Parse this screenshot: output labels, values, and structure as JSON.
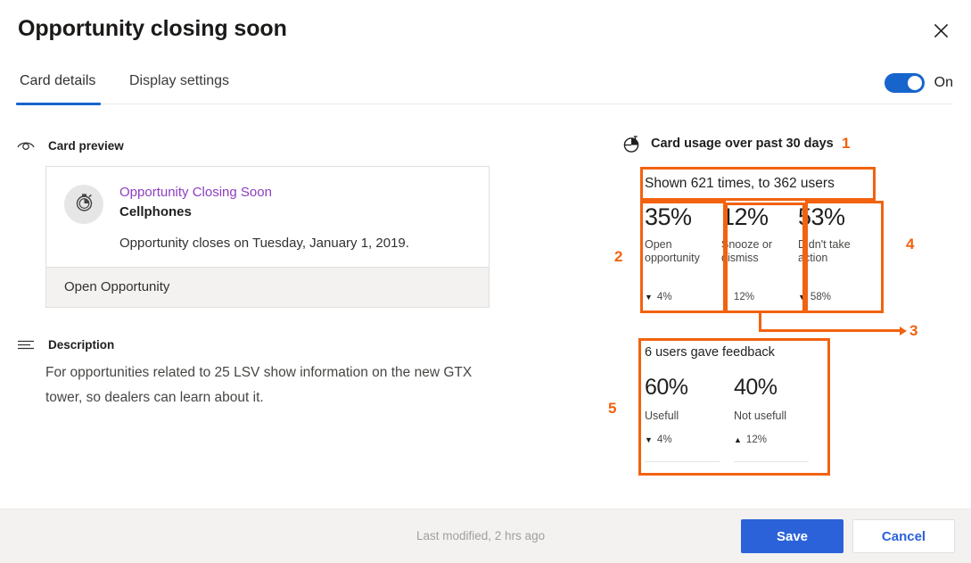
{
  "dialog": {
    "title": "Opportunity closing soon",
    "close_icon": "close-icon"
  },
  "tabs": {
    "items": [
      {
        "label": "Card details",
        "selected": true
      },
      {
        "label": "Display settings",
        "selected": false
      }
    ]
  },
  "toggle": {
    "state_label": "On",
    "on": true,
    "accent": "#1765cc"
  },
  "card_preview": {
    "section_label": "Card preview",
    "section_icon": "eye-icon",
    "avatar_icon": "stopwatch-icon",
    "link_title": "Opportunity Closing Soon",
    "subtitle": "Cellphones",
    "body_text": "Opportunity closes on Tuesday, January 1, 2019.",
    "action_label": "Open Opportunity",
    "link_color": "#8e3ec0"
  },
  "description": {
    "section_label": "Description",
    "section_icon": "lines-icon",
    "text": "For opportunities related to 25 LSV show information on the new GTX tower, so dealers can learn about it."
  },
  "usage": {
    "section_label": "Card usage over past 30 days",
    "section_icon": "pie-chart-icon",
    "shown_summary": "Shown 621 times, to 362 users",
    "stats": [
      {
        "percent": "35%",
        "name": "Open opportunity",
        "delta": "4%",
        "direction": "down"
      },
      {
        "percent": "12%",
        "name": "Snooze or dismiss",
        "delta": "12%",
        "direction": "up"
      },
      {
        "percent": "53%",
        "name": "Didn't take action",
        "delta": "58%",
        "direction": "down"
      }
    ]
  },
  "feedback": {
    "title": "6 users gave feedback",
    "items": [
      {
        "percent": "60%",
        "name": "Usefull",
        "delta": "4%",
        "direction": "down"
      },
      {
        "percent": "40%",
        "name": "Not usefull",
        "delta": "12%",
        "direction": "up"
      }
    ]
  },
  "annotations": {
    "accent": "#f2620f",
    "numbers": [
      "1",
      "2",
      "3",
      "4",
      "5"
    ]
  },
  "footer": {
    "last_modified": "Last modified, 2 hrs ago",
    "save_label": "Save",
    "cancel_label": "Cancel"
  }
}
